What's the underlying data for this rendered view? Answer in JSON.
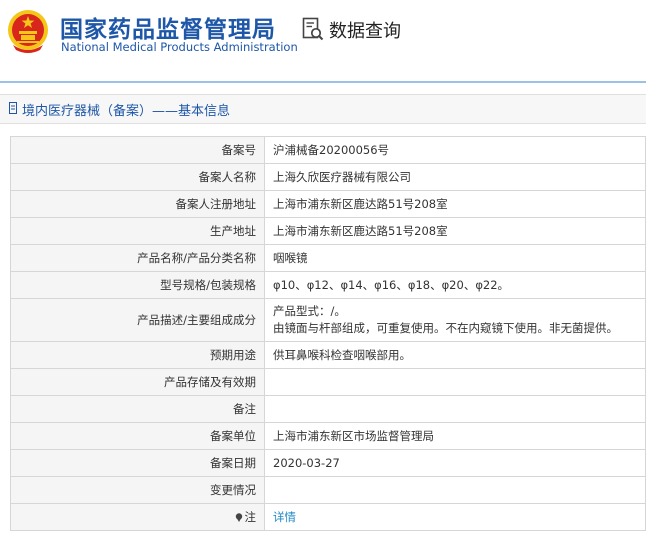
{
  "header": {
    "logo_cn": "国家药品监督管理局",
    "logo_en": "National Medical Products Administration",
    "query_label": "数据查询"
  },
  "section": {
    "title": "境内医疗器械（备案）——基本信息"
  },
  "rows": [
    {
      "label": "备案号",
      "value": "沪浦械备20200056号"
    },
    {
      "label": "备案人名称",
      "value": "上海久欣医疗器械有限公司"
    },
    {
      "label": "备案人注册地址",
      "value": "上海市浦东新区鹿达路51号208室"
    },
    {
      "label": "生产地址",
      "value": "上海市浦东新区鹿达路51号208室"
    },
    {
      "label": "产品名称/产品分类名称",
      "value": "咽喉镜"
    },
    {
      "label": "型号规格/包装规格",
      "value": "φ10、φ12、φ14、φ16、φ18、φ20、φ22。"
    },
    {
      "label": "产品描述/主要组成成分",
      "lines": [
        "产品型式：/。",
        "由镜面与杆部组成，可重复使用。不在内窥镜下使用。非无菌提供。"
      ]
    },
    {
      "label": "预期用途",
      "value": "供耳鼻喉科检查咽喉部用。"
    },
    {
      "label": "产品存储及有效期",
      "value": ""
    },
    {
      "label": "备注",
      "value": ""
    },
    {
      "label": "备案单位",
      "value": "上海市浦东新区市场监督管理局"
    },
    {
      "label": "备案日期",
      "value": "2020-03-27"
    },
    {
      "label": "变更情况",
      "value": ""
    },
    {
      "label": "注",
      "link": "详情"
    }
  ],
  "colors": {
    "brand_blue": "#1e57a8",
    "emblem_red": "#d8261c",
    "emblem_gold": "#f5c518",
    "link": "#1e88c8"
  }
}
